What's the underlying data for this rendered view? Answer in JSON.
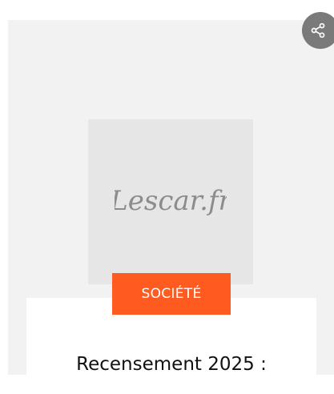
{
  "card": {
    "thumbnail": {
      "logo_text": "Lescar.fr",
      "logo_color": "#8c8c8c"
    },
    "category": {
      "label": "SOCIÉTÉ",
      "color": "#ff5a1f"
    },
    "title": "Recensement 2025 :"
  },
  "share_button": {
    "icon": "share-icon",
    "color": "#7a7a7a"
  }
}
